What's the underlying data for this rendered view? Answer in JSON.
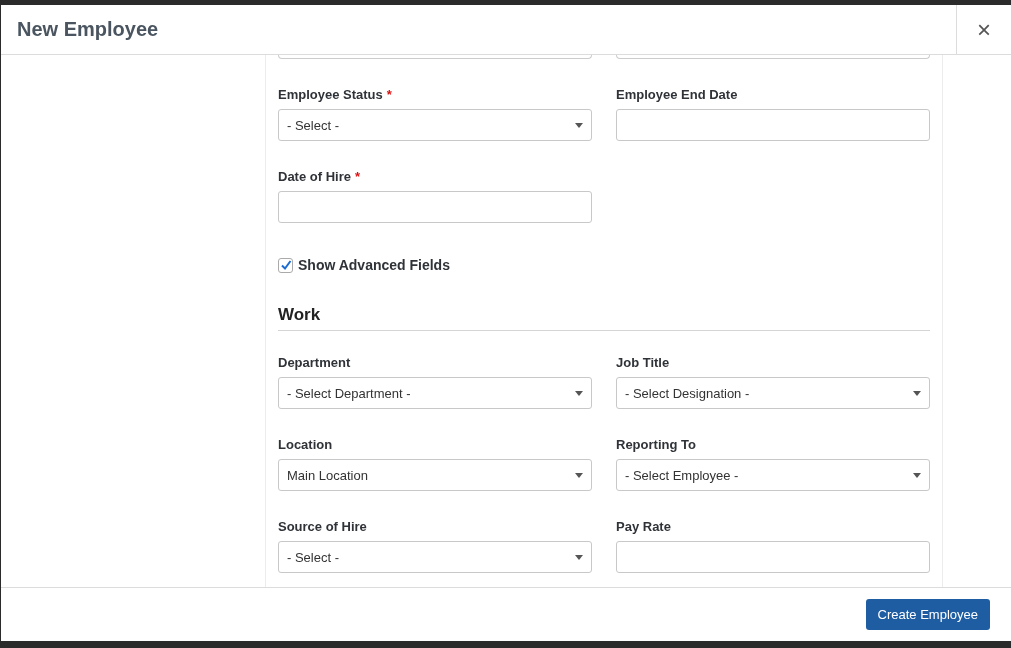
{
  "window": {
    "title": "New Employee",
    "close_label": "×"
  },
  "fields": [
    {
      "label": "Employee Status",
      "required_mark": "*",
      "kind": "select",
      "value": "- Select -"
    },
    {
      "label": "Employee End Date",
      "kind": "text"
    },
    {
      "label": "Date of Hire",
      "required_mark": "*",
      "kind": "text"
    }
  ],
  "advanced": {
    "label": "Show Advanced Fields",
    "checked": true
  },
  "work": {
    "title": "Work",
    "fields": [
      {
        "label": "Department",
        "kind": "select",
        "value": "- Select Department -"
      },
      {
        "label": "Job Title",
        "kind": "select",
        "value": "- Select Designation -"
      },
      {
        "label": "Location",
        "kind": "select",
        "value": "Main Location"
      },
      {
        "label": "Reporting To",
        "kind": "select",
        "value": "- Select Employee -"
      },
      {
        "label": "Source of Hire",
        "kind": "select",
        "value": "- Select -"
      },
      {
        "label": "Pay Rate",
        "kind": "text"
      }
    ]
  },
  "footer": {
    "button": "Create Employee"
  }
}
